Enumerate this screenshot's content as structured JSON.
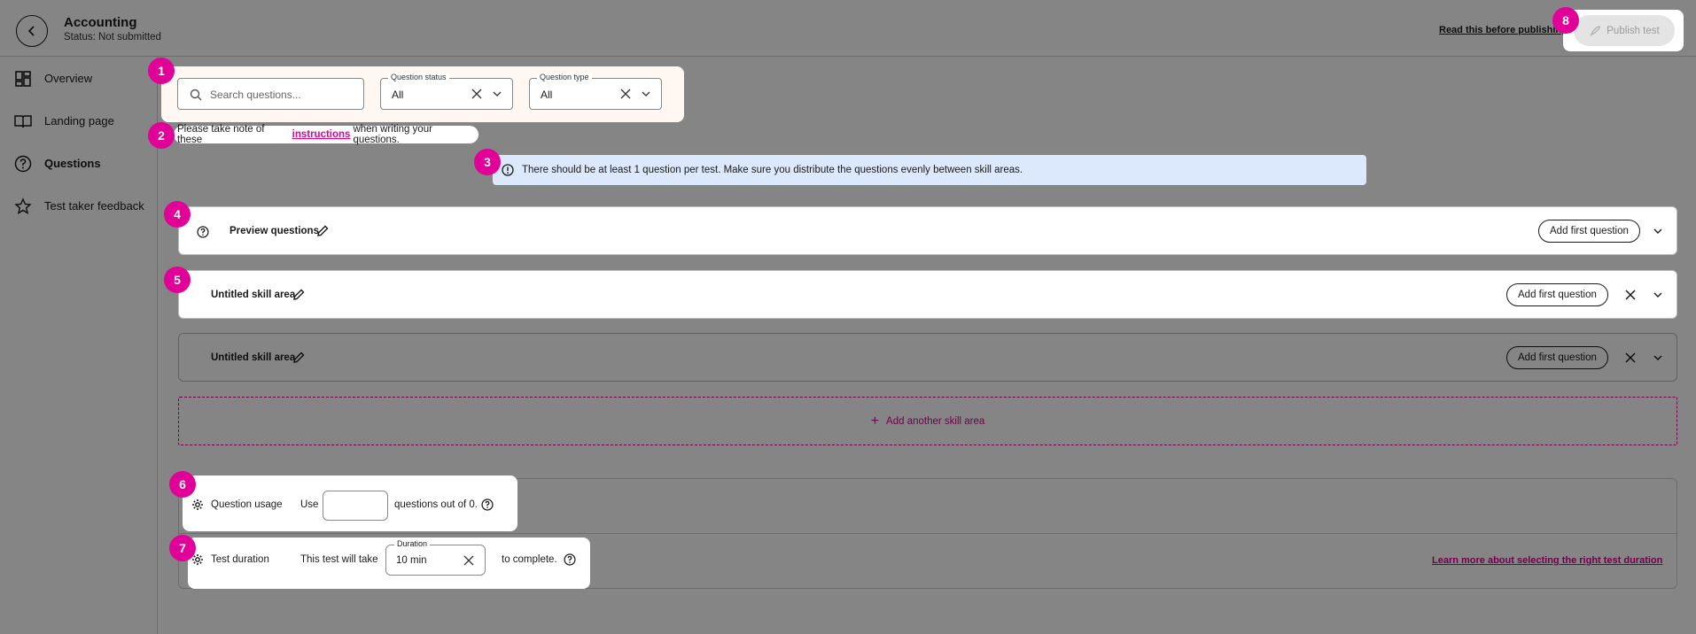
{
  "header": {
    "title": "Accounting",
    "status": "Status: Not submitted",
    "read_link": "Read this before publishing",
    "publish_label": "Publish test"
  },
  "sidebar": {
    "items": [
      {
        "label": "Overview",
        "icon": "dashboard-icon"
      },
      {
        "label": "Landing page",
        "icon": "book-icon"
      },
      {
        "label": "Questions",
        "icon": "question-circle-icon",
        "active": true
      },
      {
        "label": "Test taker feedback",
        "icon": "star-icon"
      }
    ]
  },
  "badges": [
    "1",
    "2",
    "3",
    "4",
    "5",
    "6",
    "7",
    "8"
  ],
  "filters": {
    "search_placeholder": "Search questions...",
    "status_label": "Question status",
    "status_value": "All",
    "type_label": "Question type",
    "type_value": "All"
  },
  "instructions": {
    "before": "Please take note of these",
    "link": "instructions",
    "after": "when writing your questions."
  },
  "alert": {
    "text": "There should be at least 1 question per test. Make sure you distribute the questions evenly between skill areas."
  },
  "sections": [
    {
      "name": "Preview questions",
      "button": "Add first question"
    },
    {
      "name": "Untitled skill area",
      "button": "Add first question"
    },
    {
      "name": "Untitled skill area",
      "button": "Add first question"
    }
  ],
  "add_skill_label": "Add another skill area",
  "usage": {
    "label": "Question usage",
    "use": "Use",
    "value": "",
    "suffix": "questions out of 0."
  },
  "duration": {
    "label": "Test duration",
    "prefix": "This test will take",
    "field_label": "Duration",
    "value": "10 min",
    "suffix": "to complete.",
    "learn_link": "Learn more about selecting the right test duration"
  },
  "colors": {
    "accent": "#e10098",
    "alert_bg": "#dce8fb"
  }
}
